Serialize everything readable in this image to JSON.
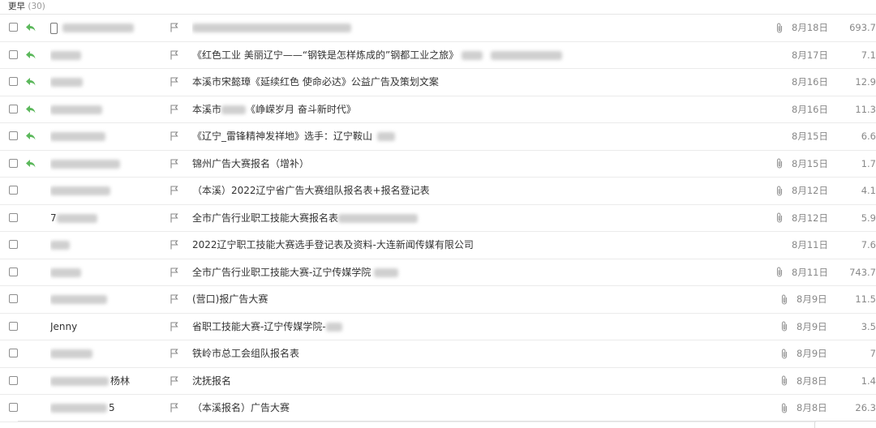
{
  "group": {
    "label": "更早",
    "count": "(30)"
  },
  "colors": {
    "reply": "#5cb85c",
    "flag": "#888888",
    "attach": "#999999",
    "blur": "#cfcfcf"
  },
  "rows": [
    {
      "sender_text": "",
      "subject": "",
      "date": "8月18日",
      "size": "693.7",
      "replied": true,
      "attach": true,
      "phone": true
    },
    {
      "sender_text": "",
      "subject": "《红色工业 美丽辽宁——“钢铁是怎样炼成的”钢都工业之旅》",
      "date": "8月17日",
      "size": "7.1",
      "replied": true,
      "attach": false
    },
    {
      "sender_text": "",
      "subject": "本溪市宋懿璋《延续红色 使命必达》公益广告及策划文案",
      "date": "8月16日",
      "size": "12.9",
      "replied": true,
      "attach": false
    },
    {
      "sender_text": "",
      "subject": "本溪市",
      "subject2": "《峥嵘岁月 奋斗新时代》",
      "date": "8月16日",
      "size": "11.3",
      "replied": true,
      "attach": false
    },
    {
      "sender_text": "",
      "subject": "《辽宁_雷锋精神发祥地》选手：辽宁鞍山",
      "date": "8月15日",
      "size": "6.6",
      "replied": true,
      "attach": false
    },
    {
      "sender_text": "",
      "subject": "锦州广告大赛报名（增补）",
      "date": "8月15日",
      "size": "1.7",
      "replied": true,
      "attach": true
    },
    {
      "sender_text": "",
      "subject": "（本溪）2022辽宁省广告大赛组队报名表+报名登记表",
      "date": "8月12日",
      "size": "4.1",
      "replied": false,
      "attach": true
    },
    {
      "sender_text": "7",
      "subject": "全市广告行业职工技能大赛报名表",
      "date": "8月12日",
      "size": "5.9",
      "replied": false,
      "attach": true
    },
    {
      "sender_text": "",
      "subject": "2022辽宁职工技能大赛选手登记表及资料-大连新闻传媒有限公司",
      "date": "8月11日",
      "size": "7.6",
      "replied": false,
      "attach": false
    },
    {
      "sender_text": "",
      "subject": "全市广告行业职工技能大赛-辽宁传媒学院",
      "date": "8月11日",
      "size": "743.7",
      "replied": false,
      "attach": true
    },
    {
      "sender_text": "",
      "subject": "(营口)报广告大赛",
      "date": "8月9日",
      "size": "11.5",
      "replied": false,
      "attach": true
    },
    {
      "sender_text": "Jenny",
      "subject": "省职工技能大赛-辽宁传媒学院-",
      "date": "8月9日",
      "size": "3.5",
      "replied": false,
      "attach": true
    },
    {
      "sender_text": "",
      "subject": "铁岭市总工会组队报名表",
      "date": "8月9日",
      "size": "7",
      "replied": false,
      "attach": true
    },
    {
      "sender_text": "杨林",
      "subject": "沈抚报名",
      "date": "8月8日",
      "size": "1.4",
      "replied": false,
      "attach": true
    },
    {
      "sender_text": "5",
      "subject": "（本溪报名）广告大赛",
      "date": "8月8日",
      "size": "26.3",
      "replied": false,
      "attach": true
    }
  ]
}
